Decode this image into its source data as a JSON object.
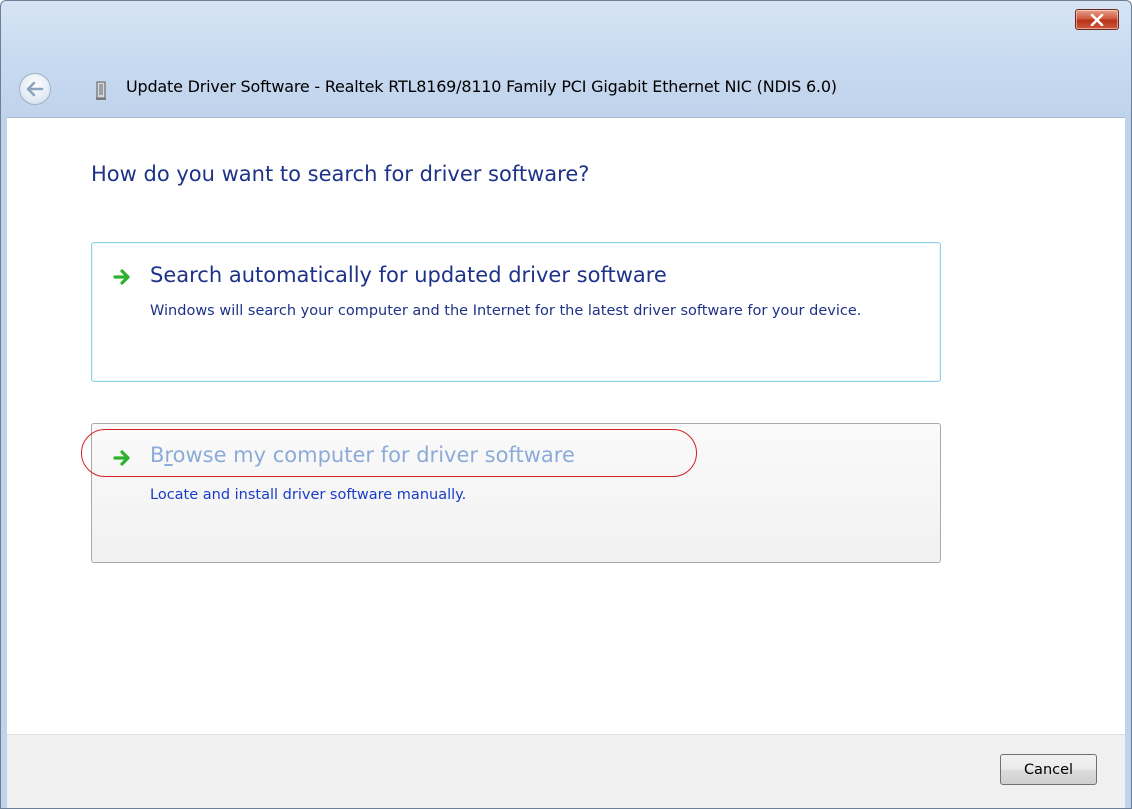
{
  "window": {
    "title": "Update Driver Software - Realtek RTL8169/8110 Family PCI Gigabit Ethernet NIC (NDIS 6.0)",
    "close_icon": "close-icon",
    "back_icon": "back-arrow-icon",
    "device_icon": "network-adapter-icon"
  },
  "page": {
    "heading": "How do you want to search for driver software?"
  },
  "options": [
    {
      "title": "Search automatically for updated driver software",
      "description": "Windows will search your computer and the Internet for the latest driver software for your device.",
      "icon": "green-arrow-icon"
    },
    {
      "title_prefix": "B",
      "title_accesskey": "r",
      "title_rest": "owse my computer for driver software",
      "description": "Locate and install driver software manually.",
      "icon": "green-arrow-icon",
      "highlighted": true
    }
  ],
  "footer": {
    "cancel_label": "Cancel"
  },
  "colors": {
    "heading": "#1e3287",
    "hover_link": "#8cabd8",
    "highlight_oval": "#d42020",
    "arrow_green": "#2fb02f"
  }
}
